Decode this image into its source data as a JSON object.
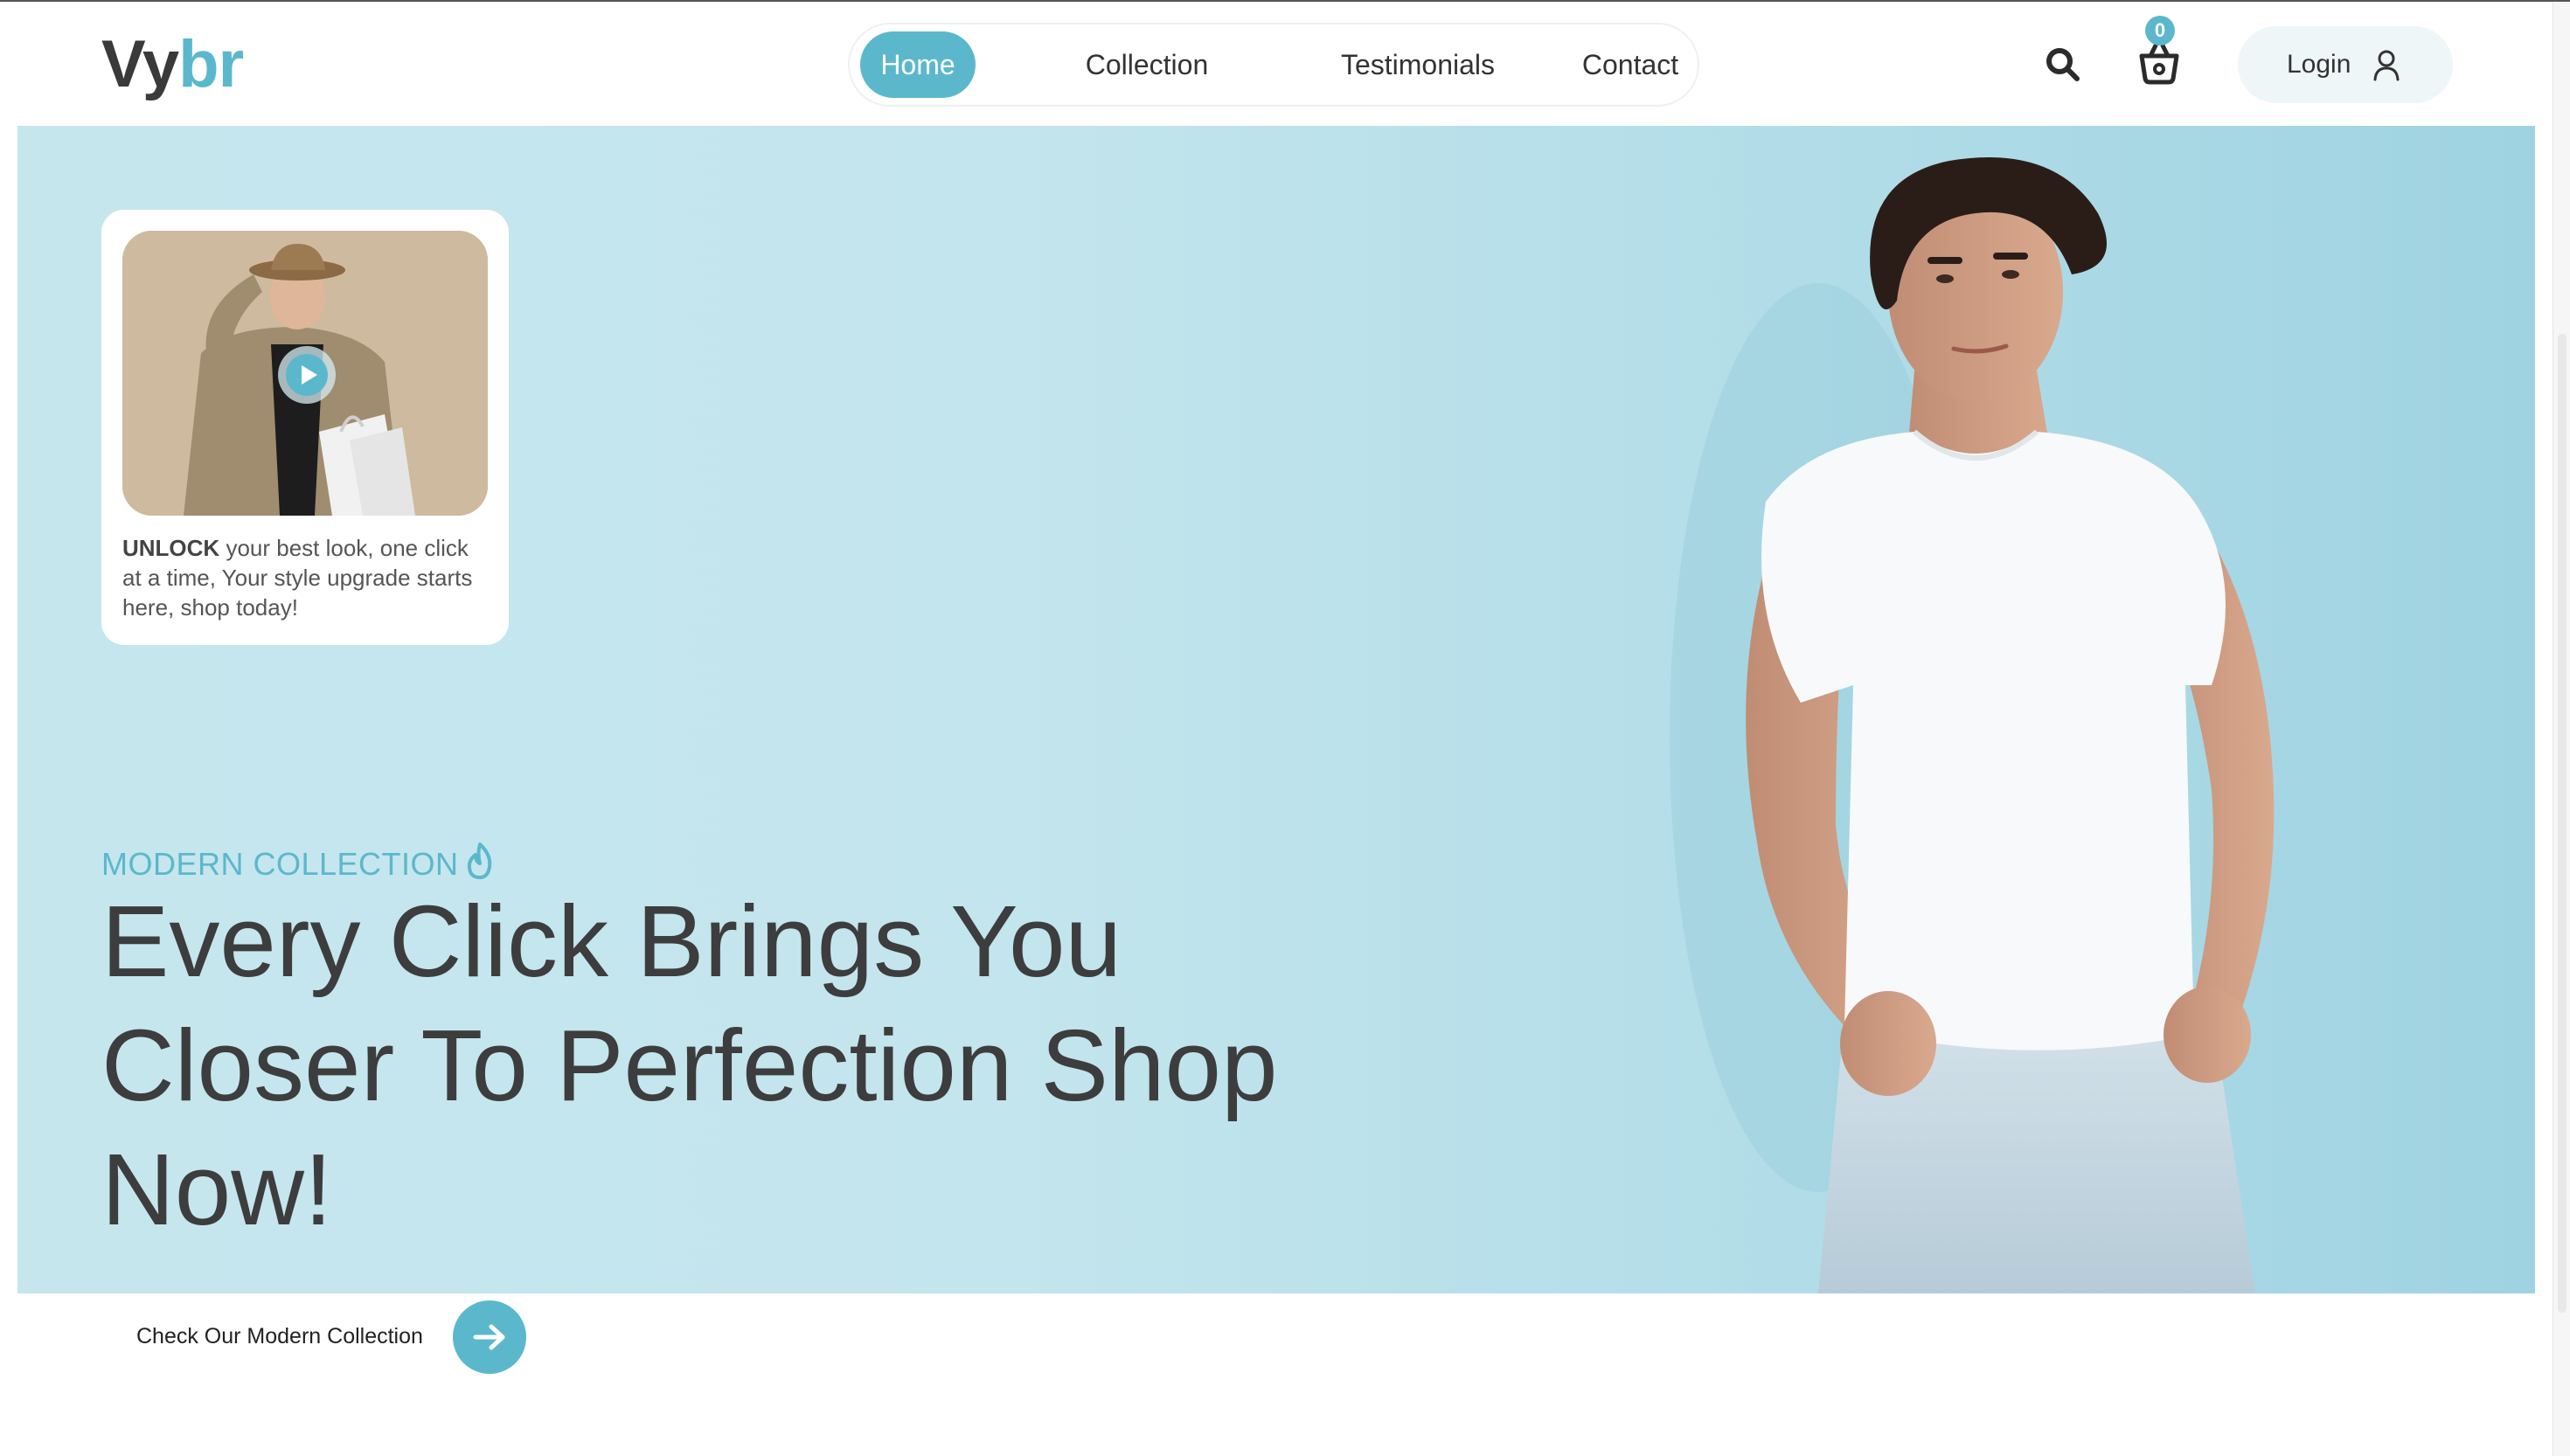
{
  "brand": {
    "logo_main": "Vy",
    "logo_accent": "br",
    "accent_color": "#5bb8cc",
    "text_color": "#3d3d3d"
  },
  "nav": {
    "items": [
      {
        "label": "Home",
        "active": true
      },
      {
        "label": "Collection",
        "active": false
      },
      {
        "label": "Testimonials",
        "active": false
      },
      {
        "label": "Contact",
        "active": false
      }
    ]
  },
  "header": {
    "search_icon": "search-icon",
    "cart_icon": "basket-icon",
    "cart_count": "0",
    "login_label": "Login",
    "login_icon": "user-icon"
  },
  "promo": {
    "video_icon": "play-icon",
    "text_bold": "UNLOCK",
    "text_rest": " your best look, one click at a time, Your style upgrade starts here, shop today!"
  },
  "hero": {
    "eyebrow": "MODERN COLLECTION",
    "eyebrow_icon": "flame-icon",
    "headline": "Every Click Brings You Closer To Perfection Shop Now!",
    "background_color": "#c3e5ed"
  },
  "cta": {
    "label": "Check Our Modern Collection",
    "icon": "arrow-right-icon"
  }
}
